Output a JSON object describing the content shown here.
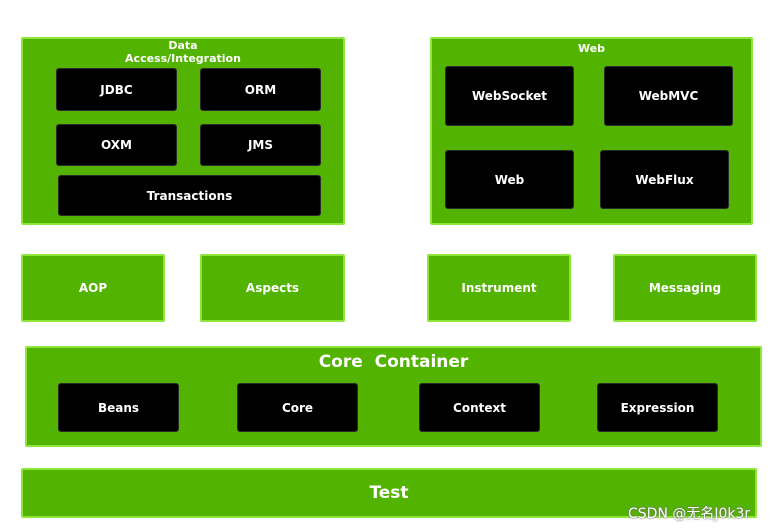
{
  "data_access": {
    "title_line1": "Data",
    "title_line2": "Access/Integration",
    "items": [
      "JDBC",
      "ORM",
      "OXM",
      "JMS",
      "Transactions"
    ]
  },
  "web": {
    "title": "Web",
    "items": [
      "WebSocket",
      "WebMVC",
      "Web",
      "WebFlux"
    ]
  },
  "middle": [
    "AOP",
    "Aspects",
    "Instrument",
    "Messaging"
  ],
  "core": {
    "title": "Core  Container",
    "items": [
      "Beans",
      "Core",
      "Context",
      "Expression"
    ]
  },
  "test": "Test",
  "watermark": "CSDN @无名J0k3r",
  "colors": {
    "module": "#52b300",
    "border": "#8ee63a",
    "inner": "#000000"
  }
}
